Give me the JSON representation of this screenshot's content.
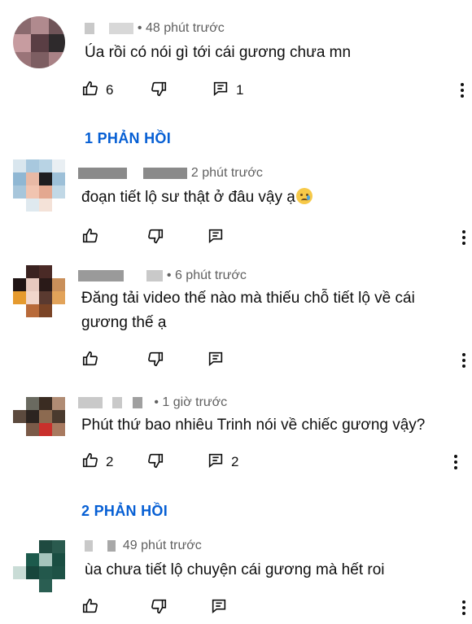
{
  "comments": [
    {
      "time": "• 48 phút trước",
      "text": "Úa rồi có nói gì tới cái gương chưa mn",
      "likes": "6",
      "replies_count": "1",
      "replies_label": "1 PHẢN HỒI"
    },
    {
      "time": "2 phút trước",
      "text": "đoạn tiết lộ sư thật ở đâu vậy ạ",
      "emoji": "crying-face-emoji"
    },
    {
      "time": "• 6 phút trước",
      "text": "Đăng tải video thế nào mà thiếu chỗ tiết lộ về cái gương thế ạ"
    },
    {
      "time": "• 1 giờ trước",
      "text": "Phút thứ bao nhiêu Trinh nói về chiếc gương vậy?",
      "likes": "2",
      "replies_count": "2",
      "replies_label": "2 PHẢN HỒI"
    },
    {
      "time": "49 phút trước",
      "text": "ùa chưa tiết lộ chuyện cái gương mà hết roi"
    }
  ],
  "colors": {
    "accent": "#065fd4",
    "text": "#0f0f0f",
    "meta": "#606060"
  },
  "icons": [
    "like-icon",
    "dislike-icon",
    "reply-icon",
    "more-icon"
  ]
}
